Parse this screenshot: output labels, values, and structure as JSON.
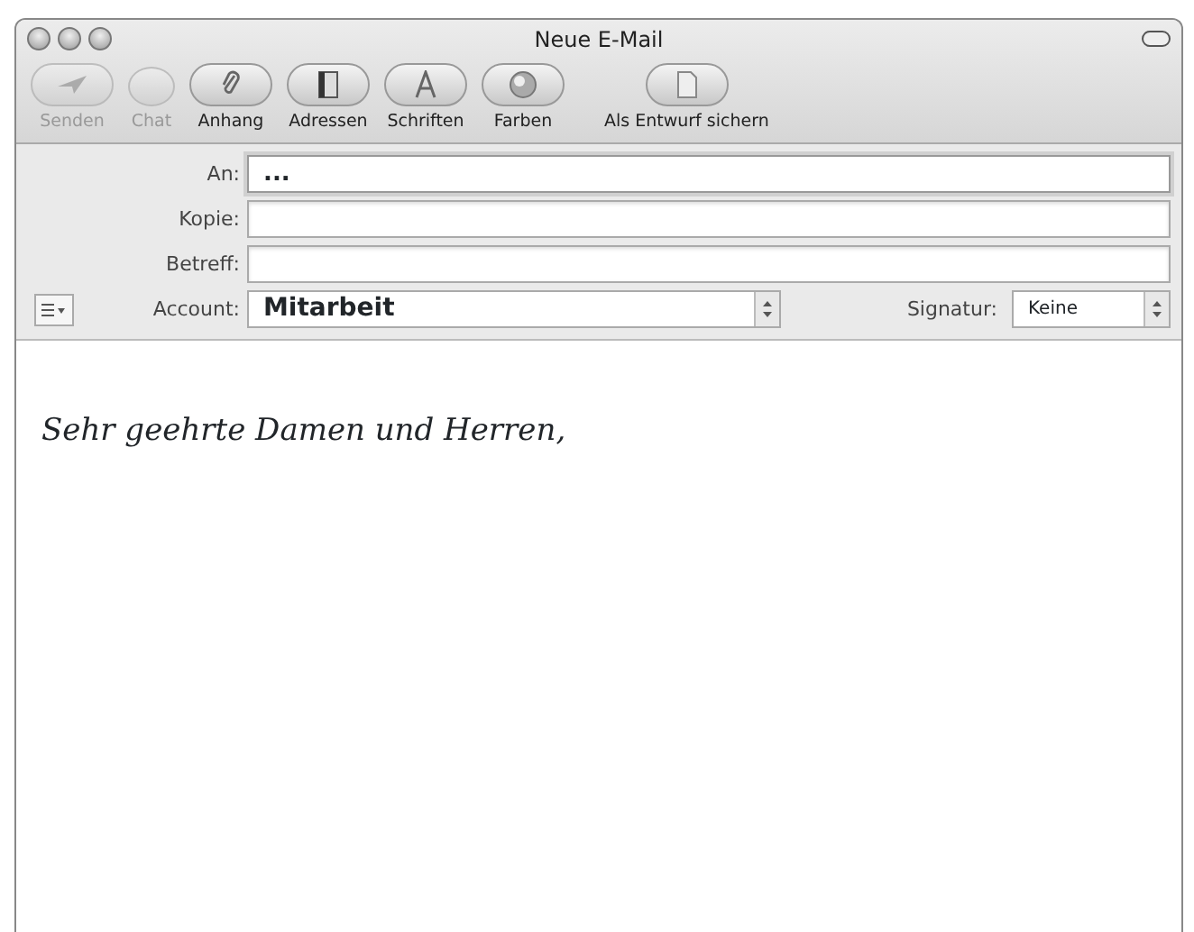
{
  "window": {
    "title": "Neue E-Mail"
  },
  "toolbar": [
    {
      "label": "Senden",
      "kind": "send",
      "disabled": true
    },
    {
      "label": "Chat",
      "kind": "chat",
      "disabled": true
    },
    {
      "label": "Anhang",
      "kind": "attach",
      "disabled": false
    },
    {
      "label": "Adressen",
      "kind": "book",
      "disabled": false
    },
    {
      "label": "Schriften",
      "kind": "font",
      "disabled": false
    },
    {
      "label": "Farben",
      "kind": "color",
      "disabled": false
    },
    {
      "label": "Als Entwurf sichern",
      "kind": "draft",
      "disabled": false
    }
  ],
  "fields": [
    {
      "label": "An:",
      "value": "...",
      "focused": true
    },
    {
      "label": "Kopie:",
      "focused": false
    },
    {
      "label": "Betreff:",
      "focused": false
    }
  ],
  "account": {
    "label": "Account:",
    "value": "Mitarbeit"
  },
  "signature": {
    "label": "Signatur:",
    "value": "Keine"
  },
  "body": "Sehr geehrte Damen und Herren,"
}
